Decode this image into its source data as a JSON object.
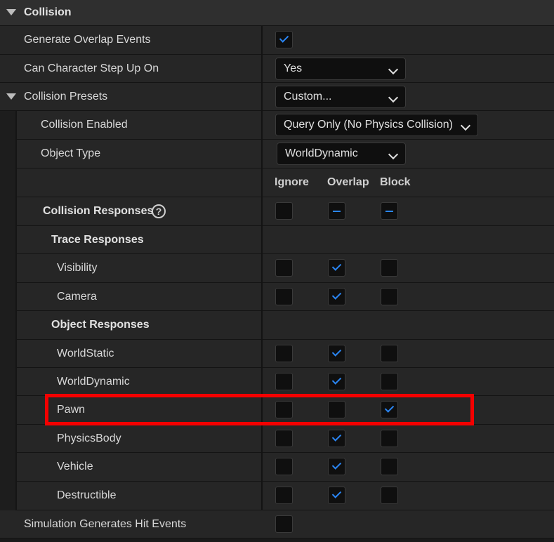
{
  "section": {
    "title": "Collision"
  },
  "generate_overlap": {
    "label": "Generate Overlap Events",
    "checked": true
  },
  "step_up": {
    "label": "Can Character Step Up On",
    "value": "Yes"
  },
  "presets": {
    "label": "Collision Presets",
    "value": "Custom..."
  },
  "enabled": {
    "label": "Collision Enabled",
    "value": "Query Only (No Physics Collision)"
  },
  "object_type": {
    "label": "Object Type",
    "value": "WorldDynamic"
  },
  "columns": {
    "ignore": "Ignore",
    "overlap": "Overlap",
    "block": "Block"
  },
  "responses": {
    "label": "Collision Responses",
    "help": "?"
  },
  "trace_responses": {
    "label": "Trace Responses"
  },
  "object_responses": {
    "label": "Object Responses"
  },
  "channels": [
    {
      "label": "Visibility",
      "response": "overlap"
    },
    {
      "label": "Camera",
      "response": "overlap"
    },
    {
      "label": "WorldStatic",
      "response": "overlap"
    },
    {
      "label": "WorldDynamic",
      "response": "overlap"
    },
    {
      "label": "Pawn",
      "response": "block"
    },
    {
      "label": "PhysicsBody",
      "response": "overlap"
    },
    {
      "label": "Vehicle",
      "response": "overlap"
    },
    {
      "label": "Destructible",
      "response": "overlap"
    }
  ],
  "sim_hit": {
    "label": "Simulation Generates Hit Events",
    "checked": false
  },
  "colors": {
    "accent": "#2a86f5",
    "highlight": "#f50000"
  }
}
